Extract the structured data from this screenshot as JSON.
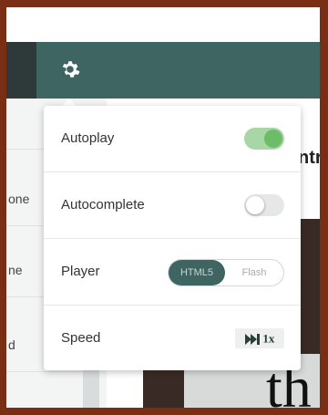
{
  "background_content": {
    "sidebar_items": [
      "one",
      "ne",
      "d"
    ],
    "title_fragment": "ntr",
    "video_text": "th"
  },
  "settings": {
    "rows": {
      "autoplay": {
        "label": "Autoplay",
        "state": "on"
      },
      "autocomplete": {
        "label": "Autocomplete",
        "state": "off"
      },
      "player": {
        "label": "Player",
        "options": [
          "HTML5",
          "Flash"
        ],
        "selected": "HTML5"
      },
      "speed": {
        "label": "Speed",
        "value": "1x"
      }
    }
  },
  "colors": {
    "teal": "#3f6562",
    "toggle_on": "#6cbc68",
    "frame": "#7a2e14"
  },
  "icons": {
    "settings": "gear-icon",
    "speed": "fast-forward-icon"
  }
}
